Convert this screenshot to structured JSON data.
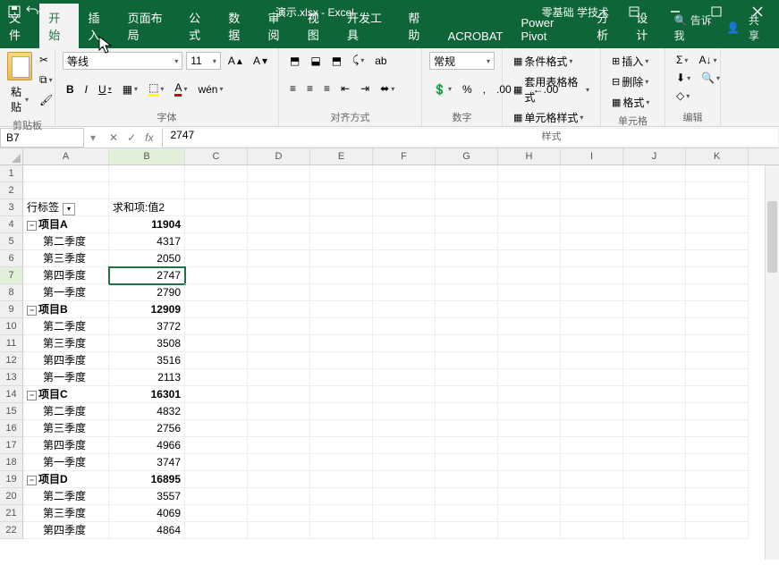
{
  "title": {
    "filename": "演示.xlsx",
    "app": "Excel",
    "account": "零基础 学技术"
  },
  "tabs": {
    "file": "文件",
    "home": "开始",
    "insert": "插入",
    "pagelayout": "页面布局",
    "formulas": "公式",
    "data": "数据",
    "review": "审阅",
    "view": "视图",
    "devtools": "开发工具",
    "help": "帮助",
    "acrobat": "ACROBAT",
    "powerpivot": "Power Pivot",
    "analyze": "分析",
    "design": "设计",
    "tellme": "告诉我",
    "share": "共享"
  },
  "ribbon": {
    "clipboard": {
      "paste": "粘贴",
      "label": "剪贴板"
    },
    "font": {
      "family": "等线",
      "size": "11",
      "label": "字体"
    },
    "alignment": {
      "wrap": "ab",
      "label": "对齐方式"
    },
    "number": {
      "general": "常规",
      "label": "数字"
    },
    "styles": {
      "cond": "条件格式",
      "table": "套用表格格式",
      "cell": "单元格样式",
      "label": "样式"
    },
    "cells": {
      "ins": "插入",
      "del": "删除",
      "fmt": "格式",
      "label": "单元格"
    },
    "editing": {
      "label": "编辑"
    }
  },
  "namebox": "B7",
  "formula": "2747",
  "cols": [
    "A",
    "B",
    "C",
    "D",
    "E",
    "F",
    "G",
    "H",
    "I",
    "J",
    "K"
  ],
  "rownums": [
    1,
    2,
    3,
    4,
    5,
    6,
    7,
    8,
    9,
    10,
    11,
    12,
    13,
    14,
    15,
    16,
    17,
    18,
    19,
    20,
    21,
    22
  ],
  "hdr": {
    "a": "行标签",
    "b": "求和项:值2"
  },
  "data_rows": [
    {
      "t": "h",
      "a": "项目A",
      "b": "11904"
    },
    {
      "t": "d",
      "a": "第二季度",
      "b": "4317"
    },
    {
      "t": "d",
      "a": "第三季度",
      "b": "2050"
    },
    {
      "t": "d",
      "a": "第四季度",
      "b": "2747",
      "active": true
    },
    {
      "t": "d",
      "a": "第一季度",
      "b": "2790"
    },
    {
      "t": "h",
      "a": "项目B",
      "b": "12909"
    },
    {
      "t": "d",
      "a": "第二季度",
      "b": "3772"
    },
    {
      "t": "d",
      "a": "第三季度",
      "b": "3508"
    },
    {
      "t": "d",
      "a": "第四季度",
      "b": "3516"
    },
    {
      "t": "d",
      "a": "第一季度",
      "b": "2113"
    },
    {
      "t": "h",
      "a": "项目C",
      "b": "16301"
    },
    {
      "t": "d",
      "a": "第二季度",
      "b": "4832"
    },
    {
      "t": "d",
      "a": "第三季度",
      "b": "2756"
    },
    {
      "t": "d",
      "a": "第四季度",
      "b": "4966"
    },
    {
      "t": "d",
      "a": "第一季度",
      "b": "3747"
    },
    {
      "t": "h",
      "a": "项目D",
      "b": "16895"
    },
    {
      "t": "d",
      "a": "第二季度",
      "b": "3557"
    },
    {
      "t": "d",
      "a": "第三季度",
      "b": "4069"
    },
    {
      "t": "d",
      "a": "第四季度",
      "b": "4864"
    }
  ]
}
